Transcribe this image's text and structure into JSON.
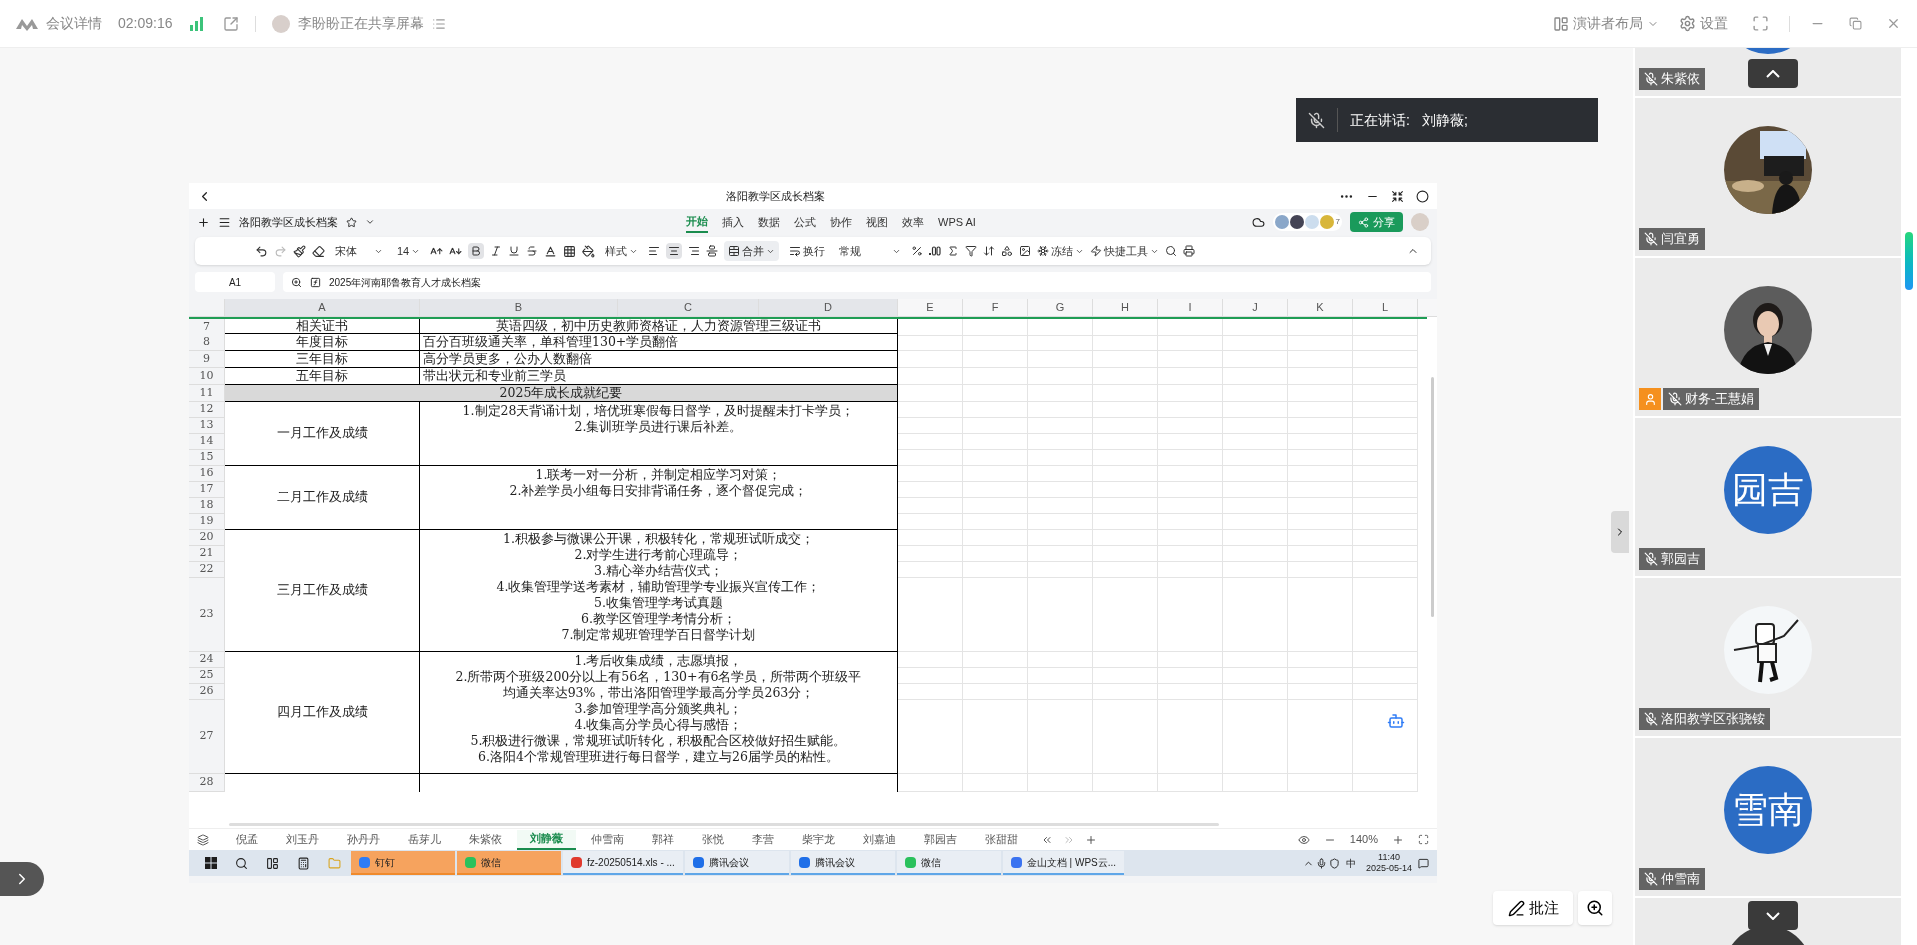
{
  "topbar": {
    "title": "会议详情",
    "duration": "02:09:16",
    "sharer": "李盼盼正在共享屏幕",
    "layout": "演讲者布局",
    "settings": "设置"
  },
  "speaking": {
    "label": "正在讲话:",
    "name": "刘静薇;"
  },
  "sheet": {
    "title": "洛阳教学区成长档案",
    "doc_name": "洛阳教学区成长档案",
    "menu": [
      {
        "label": "开始",
        "selected": true
      },
      {
        "label": "插入",
        "selected": false
      },
      {
        "label": "数据",
        "selected": false
      },
      {
        "label": "公式",
        "selected": false
      },
      {
        "label": "协作",
        "selected": false
      },
      {
        "label": "视图",
        "selected": false
      },
      {
        "label": "效率",
        "selected": false
      },
      {
        "label": "WPS AI",
        "selected": false
      }
    ],
    "collaborator_count": "7",
    "share": "分享",
    "toolbar": {
      "font": "宋体",
      "size": "14",
      "bold": true,
      "align_center": true,
      "style": "样式",
      "merge": "合并",
      "wrap": "换行",
      "format": "常规",
      "freeze": "冻结",
      "tools": "快捷工具"
    },
    "cell_ref": "A1",
    "formula": "2025年河南耶鲁教育人才成长档案",
    "columns": [
      {
        "label": "A",
        "selected": true
      },
      {
        "label": "B",
        "selected": true
      },
      {
        "label": "C",
        "selected": true
      },
      {
        "label": "D",
        "selected": true
      },
      {
        "label": "E",
        "selected": false
      },
      {
        "label": "F",
        "selected": false
      },
      {
        "label": "G",
        "selected": false
      },
      {
        "label": "H",
        "selected": false
      },
      {
        "label": "I",
        "selected": false
      },
      {
        "label": "J",
        "selected": false
      },
      {
        "label": "K",
        "selected": false
      },
      {
        "label": "L",
        "selected": false
      }
    ],
    "blocks": [
      {
        "kind": "record",
        "rows": [
          "7"
        ],
        "label": "相关证书",
        "lines": [
          "英语四级，初中历史教师资格证，人力资源管理三级证书"
        ]
      },
      {
        "kind": "goal",
        "rows": [
          "8"
        ],
        "label": "年度目标",
        "lines": [
          "百分百班级通关率，单科管理130+学员翻倍"
        ]
      },
      {
        "kind": "goal",
        "rows": [
          "9"
        ],
        "label": "三年目标",
        "lines": [
          "高分学员更多，公办人数翻倍"
        ]
      },
      {
        "kind": "goal",
        "rows": [
          "10"
        ],
        "label": "五年目标",
        "lines": [
          "带出状元和专业前三学员"
        ]
      },
      {
        "kind": "heading",
        "rows": [
          "11"
        ],
        "title": "2025年成长成就纪要"
      },
      {
        "kind": "record",
        "rows": [
          "12",
          "13",
          "14",
          "15"
        ],
        "label": "一月工作及成绩",
        "lines": [
          "1.制定28天背诵计划，培优班寒假每日督学，及时提醒未打卡学员；",
          "2.集训班学员进行课后补差。"
        ]
      },
      {
        "kind": "record",
        "rows": [
          "16",
          "17",
          "18",
          "19"
        ],
        "label": "二月工作及成绩",
        "lines": [
          "1.联考一对一分析，并制定相应学习对策；",
          "2.补差学员小组每日安排背诵任务，逐个督促完成；"
        ]
      },
      {
        "kind": "record",
        "rows": [
          "20",
          "21",
          "22",
          "23"
        ],
        "label": "三月工作及成绩",
        "lines": [
          "1.积极参与微课公开课，积极转化，常规班试听成交；",
          "2.对学生进行考前心理疏导；",
          "3.精心举办结营仪式；",
          "4.收集管理学送考素材，辅助管理学专业振兴宣传工作；",
          "5.收集管理学考试真题",
          "6.教学区管理学考情分析；",
          "7.制定常规班管理学百日督学计划"
        ]
      },
      {
        "kind": "record",
        "rows": [
          "24",
          "25",
          "26",
          "27"
        ],
        "label": "四月工作及成绩",
        "lines": [
          "1.考后收集成绩，志愿填报，",
          "2.所带两个班级200分以上有56名，130+有6名学员，所带两个班级平",
          "均通关率达93%，带出洛阳管理学最高分学员263分；",
          "3.参加管理学高分颁奖典礼；",
          "4.收集高分学员心得与感悟；",
          "5.积极进行微课，常规班试听转化，积极配合区校做好招生赋能。",
          "6.洛阳4个常规管理班进行每日督学，建立与26届学员的粘性。"
        ]
      },
      {
        "kind": "empty",
        "rows": [
          "28"
        ]
      }
    ],
    "sheets": [
      {
        "label": "倪孟",
        "selected": false
      },
      {
        "label": "刘玉丹",
        "selected": false
      },
      {
        "label": "孙丹丹",
        "selected": false
      },
      {
        "label": "岳芽儿",
        "selected": false
      },
      {
        "label": "朱紫依",
        "selected": false
      },
      {
        "label": "刘静薇",
        "selected": true
      },
      {
        "label": "仲雪南",
        "selected": false
      },
      {
        "label": "郭祥",
        "selected": false
      },
      {
        "label": "张悦",
        "selected": false
      },
      {
        "label": "李营",
        "selected": false
      },
      {
        "label": "柴宇龙",
        "selected": false
      },
      {
        "label": "刘嘉迪",
        "selected": false
      },
      {
        "label": "郭园吉",
        "selected": false
      },
      {
        "label": "张甜甜",
        "selected": false
      }
    ],
    "zoom": "140%"
  },
  "taskbar": {
    "apps": [
      {
        "kind": "dingtalk",
        "label": "钉钉",
        "flashing": true
      },
      {
        "kind": "wechat",
        "label": "微信",
        "flashing": true
      },
      {
        "kind": "wps",
        "label": "fz-20250514.xls - ...",
        "flashing": false
      },
      {
        "kind": "meeting",
        "label": "腾讯会议",
        "flashing": false
      },
      {
        "kind": "meeting",
        "label": "腾讯会议",
        "flashing": false
      },
      {
        "kind": "wechat",
        "label": "微信",
        "flashing": false
      },
      {
        "kind": "kdocs",
        "label": "金山文档 | WPS云...",
        "flashing": false
      }
    ],
    "ime": "中",
    "time": "11:40",
    "date": "2025-05-14"
  },
  "participants": [
    {
      "name": "朱紫依",
      "muted": true,
      "host": false,
      "avatar": {
        "kind": "plain",
        "color": "#2b6cc4"
      }
    },
    {
      "name": "闫宜勇",
      "muted": true,
      "host": false,
      "avatar": {
        "kind": "room"
      }
    },
    {
      "name": "财务-王慧娟",
      "muted": true,
      "host": true,
      "avatar": {
        "kind": "portrait"
      }
    },
    {
      "name": "郭园吉",
      "muted": true,
      "host": false,
      "avatar": {
        "kind": "text",
        "text": "园吉"
      }
    },
    {
      "name": "洛阳教学区张骁铵",
      "muted": true,
      "host": false,
      "avatar": {
        "kind": "sketch"
      }
    },
    {
      "name": "仲雪南",
      "muted": true,
      "host": false,
      "avatar": {
        "kind": "text",
        "text": "雪南"
      }
    },
    {
      "avatar": {
        "kind": "plain",
        "color": "#3a3a3a"
      }
    }
  ],
  "annotate": "批注"
}
